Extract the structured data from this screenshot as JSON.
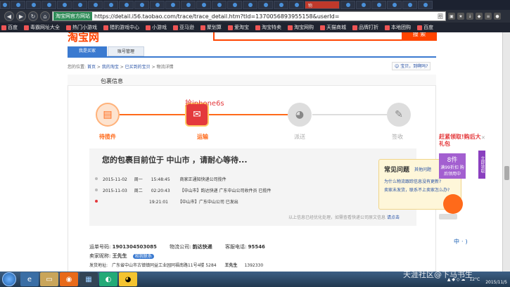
{
  "browser": {
    "active_tab": "物",
    "site_badge": "淘宝网官方网站",
    "url": "https://detail.i56.taobao.com/trace/trace_detail.htm?tId=1370056893955158&userId=",
    "url_hint": "圈",
    "bookmarks": [
      "百度",
      "毒霸网址大全",
      "热门小游戏",
      "猎豹游戏中心",
      "小游戏",
      "亚马逊",
      "聚划算",
      "爱淘宝",
      "淘宝特卖",
      "淘宝网购",
      "天猫商城",
      "品牌打折",
      "本地团购",
      "百度"
    ]
  },
  "header": {
    "logo": "淘宝网",
    "search_button": "搜 索",
    "tabs": [
      "我是买家",
      "账号管理"
    ]
  },
  "breadcrumb": {
    "prefix": "您的位置:",
    "items": [
      "首页",
      "我的淘宝",
      "已买到的宝贝",
      "物流详情"
    ]
  },
  "wangwang": "宝贝，到啊吗?",
  "package": {
    "title": "包裹信息",
    "promo": "抢iphone6s",
    "steps": [
      "待揽件",
      "运输",
      "派送",
      "签收"
    ],
    "status_prefix": "您的包裹目前位于",
    "status_city": "中山市",
    "status_suffix": "，请耐心等待...",
    "events": [
      {
        "date": "2015-11-02",
        "weekday": "周一",
        "time": "15:48:45",
        "desc": "商家正通知快递公司揽件"
      },
      {
        "date": "2015-11-03",
        "weekday": "周二",
        "time": "02:20:43",
        "desc": "【中山市】韵达快递 广东中山公司收件员 已揽件"
      },
      {
        "date": "",
        "weekday": "",
        "time": "19:21:01",
        "desc": "【中山市】广东中山公司 已发出"
      }
    ],
    "footnote": "以上信息已经优化处理，如需查看快递公司原文信息",
    "footnote_link": "请点击"
  },
  "waybill": {
    "no_label": "运单号码:",
    "no": "1901304503085",
    "company_label": "物流公司:",
    "company": "韵达快递",
    "phone_label": "客服电话:",
    "phone": "95546",
    "seller_label": "卖家昵称:",
    "seller": "王先生",
    "contact": "和我联系",
    "address_label": "发货地址:",
    "address": "广东省中山市古镇镇同益工业园同福南路11号4楼 5284",
    "addr_name": "王先生",
    "addr_phone": "1392330"
  },
  "faq": {
    "title": "常见问题",
    "more": "其他问题",
    "items": [
      "为什么物流跟踪信息没有更新?",
      "卖家未发货，联系不上卖家怎么办?"
    ]
  },
  "gift": {
    "title": "赶紧领取!购后大礼包",
    "badge": "8件",
    "sub": "满99折扣 购后领用中",
    "side": "立即领取"
  },
  "ime": "中·)",
  "taskbar": {
    "temp": "12°C",
    "date": "2015/11/5"
  },
  "watermark": "天涯社区@下马书生"
}
